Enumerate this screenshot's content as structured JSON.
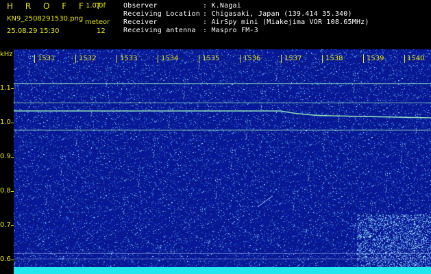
{
  "header": {
    "title": "H R O F F T",
    "version": "1.0.0f",
    "filename": "KN9_2508291530.png",
    "datetime": "25.08.29 15:30",
    "meteor_label": "meteor",
    "meteor_count": "12"
  },
  "info": {
    "rows": [
      {
        "label": "Observer",
        "value": ": K.Nagai"
      },
      {
        "label": "Receiving Location",
        "value": ": Chigasaki, Japan (139.414 35.340)"
      },
      {
        "label": "Receiver",
        "value": ": AirSpy mini (Miakejima VOR 108.65MHz)"
      },
      {
        "label": "Receiving antenna",
        "value": ": Maspro FM-3"
      }
    ]
  },
  "axis": {
    "unit": "kHz",
    "y_ticks": [
      "1.1",
      "1.0",
      "0.9",
      "0.8",
      "0.7",
      "0.6"
    ],
    "x_ticks": [
      "1531",
      "1532",
      "1533",
      "1534",
      "1535",
      "1536",
      "1537",
      "1538",
      "1539",
      "1540"
    ]
  },
  "colors": {
    "accent": "#e8e800",
    "background": "#0a1a8a",
    "signal": "#9cf0c0",
    "baseline": "#21e6ee"
  }
}
